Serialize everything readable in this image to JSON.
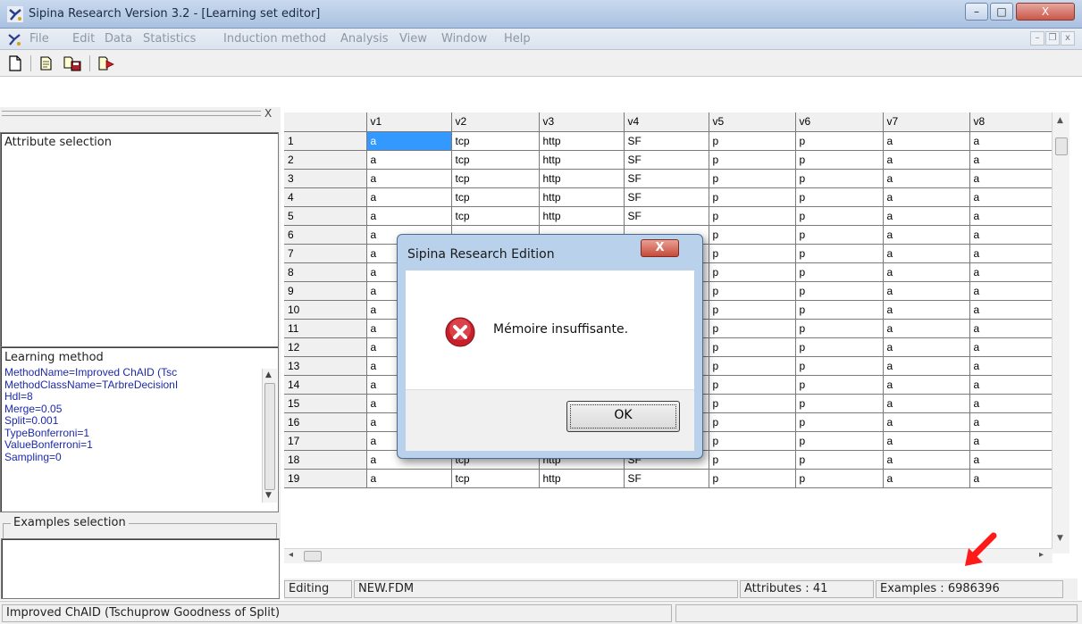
{
  "window": {
    "title": "Sipina Research Version 3.2 - [Learning set editor]",
    "controls": {
      "minimize": "–",
      "maximize": "□",
      "close": "X"
    }
  },
  "menubar": {
    "items": [
      "File",
      "Edit",
      "Data",
      "Statistics",
      "Induction method",
      "Analysis",
      "View",
      "Window",
      "Help"
    ],
    "mdi": {
      "minimize": "–",
      "restore": "❐",
      "close": "x"
    }
  },
  "toolbar": {
    "icons": [
      "new-file-icon",
      "open-file-icon",
      "save-files-icon",
      "execute-icon"
    ]
  },
  "left_panel": {
    "close_glyph": "X",
    "attribute_selection_label": "Attribute selection",
    "learning_method_label": "Learning method",
    "method_lines": [
      "MethodName=Improved ChAID (Tsc",
      "MethodClassName=TArbreDecisionI",
      "Hdl=8",
      "Merge=0.05",
      "Split=0.001",
      "TypeBonferroni=1",
      "ValueBonferroni=1",
      "Sampling=0"
    ],
    "examples_selection_label": "Examples selection"
  },
  "grid": {
    "columns": [
      "v1",
      "v2",
      "v3",
      "v4",
      "v5",
      "v6",
      "v7",
      "v8"
    ],
    "rows": [
      {
        "n": "1",
        "v": [
          "a",
          "tcp",
          "http",
          "SF",
          "p",
          "p",
          "a",
          "a"
        ]
      },
      {
        "n": "2",
        "v": [
          "a",
          "tcp",
          "http",
          "SF",
          "p",
          "p",
          "a",
          "a"
        ]
      },
      {
        "n": "3",
        "v": [
          "a",
          "tcp",
          "http",
          "SF",
          "p",
          "p",
          "a",
          "a"
        ]
      },
      {
        "n": "4",
        "v": [
          "a",
          "tcp",
          "http",
          "SF",
          "p",
          "p",
          "a",
          "a"
        ]
      },
      {
        "n": "5",
        "v": [
          "a",
          "tcp",
          "http",
          "SF",
          "p",
          "p",
          "a",
          "a"
        ]
      },
      {
        "n": "6",
        "v": [
          "a",
          "",
          "",
          "",
          "p",
          "p",
          "a",
          "a"
        ]
      },
      {
        "n": "7",
        "v": [
          "a",
          "",
          "",
          "",
          "p",
          "p",
          "a",
          "a"
        ]
      },
      {
        "n": "8",
        "v": [
          "a",
          "",
          "",
          "",
          "p",
          "p",
          "a",
          "a"
        ]
      },
      {
        "n": "9",
        "v": [
          "a",
          "",
          "",
          "",
          "p",
          "p",
          "a",
          "a"
        ]
      },
      {
        "n": "10",
        "v": [
          "a",
          "",
          "",
          "",
          "p",
          "p",
          "a",
          "a"
        ]
      },
      {
        "n": "11",
        "v": [
          "a",
          "",
          "",
          "",
          "p",
          "p",
          "a",
          "a"
        ]
      },
      {
        "n": "12",
        "v": [
          "a",
          "",
          "",
          "",
          "p",
          "p",
          "a",
          "a"
        ]
      },
      {
        "n": "13",
        "v": [
          "a",
          "",
          "",
          "",
          "p",
          "p",
          "a",
          "a"
        ]
      },
      {
        "n": "14",
        "v": [
          "a",
          "",
          "",
          "",
          "p",
          "p",
          "a",
          "a"
        ]
      },
      {
        "n": "15",
        "v": [
          "a",
          "tcp",
          "http",
          "SF",
          "p",
          "p",
          "a",
          "a"
        ]
      },
      {
        "n": "16",
        "v": [
          "a",
          "tcp",
          "http",
          "SF",
          "p",
          "p",
          "a",
          "a"
        ]
      },
      {
        "n": "17",
        "v": [
          "a",
          "tcp",
          "http",
          "SF",
          "p",
          "p",
          "a",
          "a"
        ]
      },
      {
        "n": "18",
        "v": [
          "a",
          "tcp",
          "http",
          "SF",
          "p",
          "p",
          "a",
          "a"
        ]
      },
      {
        "n": "19",
        "v": [
          "a",
          "tcp",
          "http",
          "SF",
          "p",
          "p",
          "a",
          "a"
        ]
      }
    ],
    "selected_cell": {
      "row": 0,
      "col": 0
    }
  },
  "grid_status": {
    "mode": "Editing",
    "file": "NEW.FDM",
    "attributes": "Attributes : 41",
    "examples": "Examples : 6986396"
  },
  "status_bar": {
    "text": "Improved ChAID (Tschuprow Goodness of Split)"
  },
  "dialog": {
    "title": "Sipina Research Edition",
    "message": "Mémoire insuffisante.",
    "ok_label": "OK",
    "close_glyph": "X"
  },
  "colors": {
    "selection": "#3399ff",
    "method_text": "#1d2aa8",
    "annotation_arrow": "#ff1a1a"
  }
}
